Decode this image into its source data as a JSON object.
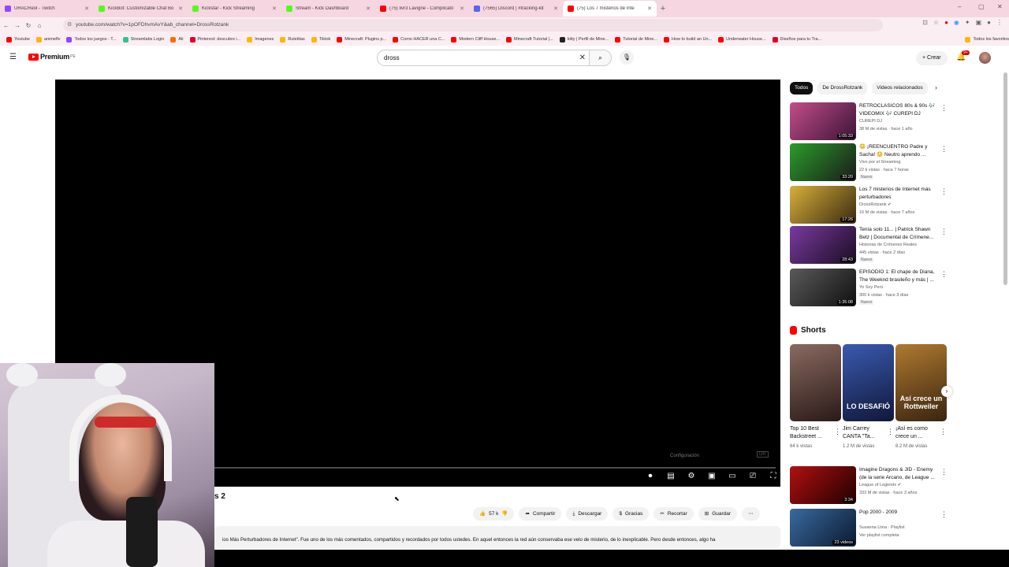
{
  "browser": {
    "tabs": [
      {
        "label": "URACReol - Twitch",
        "color": "#9146ff",
        "active": false
      },
      {
        "label": "KickBot: Customizable Chat Bo",
        "color": "#53fc18",
        "active": false
      },
      {
        "label": "Kickstar - Kick Streaming",
        "color": "#53fc18",
        "active": false
      },
      {
        "label": "Stream - Kick Dashboard",
        "color": "#53fc18",
        "active": false
      },
      {
        "label": "(75) livr3 Lavigne - Complicato",
        "color": "#ff0000",
        "active": false
      },
      {
        "label": "(7565) Discord | #tracking-kit",
        "color": "#5865f2",
        "active": false
      },
      {
        "label": "(75) Los 7 misterios de Inte",
        "color": "#ff0000",
        "active": true
      }
    ],
    "new_tab": "+",
    "window_controls": [
      "–",
      "▢",
      "✕"
    ],
    "url": "youtube.com/watch?v=1pOFDhvmAvY&ab_channel=DrossRotzank",
    "bookmarks": [
      {
        "label": "Youtube",
        "color": "#ff0000"
      },
      {
        "label": "animeflv",
        "color": "#ffb703"
      },
      {
        "label": "Todos los juegos - T...",
        "color": "#9146ff"
      },
      {
        "label": "Streamlabs Login",
        "color": "#31c48d"
      },
      {
        "label": "Ali",
        "color": "#ff6a00"
      },
      {
        "label": "Pinterest: descubre i...",
        "color": "#e60023"
      },
      {
        "label": "Imagenes",
        "color": "#ffb703"
      },
      {
        "label": "Ruletitas",
        "color": "#ffb703"
      },
      {
        "label": "Tiktok",
        "color": "#ffb703"
      },
      {
        "label": "Minecraft: Plugins p...",
        "color": "#ff0000"
      },
      {
        "label": "Como HACER una C...",
        "color": "#ff0000"
      },
      {
        "label": "Modern Cliff House...",
        "color": "#ff0000"
      },
      {
        "label": "Minecraft Tutorial |...",
        "color": "#ff0000"
      },
      {
        "label": "kitty | Perfil de Mine...",
        "color": "#222222"
      },
      {
        "label": "Tutorial de Mine...",
        "color": "#ff0000"
      },
      {
        "label": "How to build an Un...",
        "color": "#ff0000"
      },
      {
        "label": "Underwater House...",
        "color": "#ff0000"
      },
      {
        "label": "Diseños para tu Tra...",
        "color": "#e60023"
      },
      {
        "label": "Todos los favoritos",
        "color": "#ffb703"
      }
    ]
  },
  "youtube": {
    "logo_text": "Premium",
    "logo_sup": "PE",
    "search_value": "dross",
    "create_label": "Crear",
    "notif_count": "9+"
  },
  "player": {
    "config_label": "Configuración",
    "watermark": "DR"
  },
  "video": {
    "title_fragment": "s 2",
    "likes": "57 k",
    "actions": [
      "Compartir",
      "Descargar",
      "Gracias",
      "Recortar",
      "Guardar"
    ],
    "description": "ios Más Perturbadores de Internet\". Fue uno de los más comentados, compartidos y recordados por todos ustedes. En aquel entonces la red aún conservaba ese velo de misterio, de lo inexplicable. Pero desde entonces, algo ha"
  },
  "sidebar": {
    "chips": [
      "Todos",
      "De DrossRotzank",
      "Videos relacionados"
    ],
    "recs": [
      {
        "title": "RETROCLASICOS 80s & 90s 🎶 VIDEOMIX 🎶 CUREPI DJ",
        "channel": "CUREPI DJ",
        "meta": "38 M de vistas · hace 1 año",
        "duration": "1:05:33",
        "is_new": "",
        "thumb": [
          "#c44d8a",
          "#3a1436"
        ]
      },
      {
        "title": "😳 ¡REENCUENTRO Padre y Sacha! 😳 Neutro aprendo ...",
        "channel": "Vivo por el Streaming",
        "meta": "22 k vistas · hace 7 horas",
        "duration": "33:20",
        "is_new": "Nuevo",
        "thumb": [
          "#2a9d2a",
          "#1a1a1a"
        ]
      },
      {
        "title": "Los 7 misterios de Internet más perturbadores",
        "channel": "DrossRotzank ✔",
        "meta": "16 M de vistas · hace 7 años",
        "duration": "17:26",
        "is_new": "",
        "thumb": [
          "#d8b03a",
          "#3a2a10"
        ]
      },
      {
        "title": "Tenía solo 11... | Patrick Shawn Betz | Documental de Crímene...",
        "channel": "Historias de Crímenes Reales",
        "meta": "445 vistas · hace 2 días",
        "duration": "28:43",
        "is_new": "Nuevo",
        "thumb": [
          "#7a3aa0",
          "#1a0d22"
        ]
      },
      {
        "title": "EPISODIO 1: El chape de Diana, The Weeknd brasileño y más | ...",
        "channel": "Yo Soy Perú",
        "meta": "300 k vistas · hace 3 días",
        "duration": "1:35:08",
        "is_new": "Nuevo",
        "thumb": [
          "#5a5a5a",
          "#101010"
        ]
      }
    ],
    "shorts_header": "Shorts",
    "shorts": [
      {
        "title": "Top 10 Best Backstreet ...",
        "views": "64 k vistas",
        "caption": "",
        "colors": [
          "#8a6a60",
          "#2a1a18"
        ]
      },
      {
        "title": "Jim Carrey CANTA \"Ta...",
        "views": "1.2 M de vistas",
        "caption": "LO DESAFIÓ",
        "colors": [
          "#3a5ab0",
          "#10183a"
        ]
      },
      {
        "title": "¡Así es como crece un ...",
        "views": "8.2 M de vistas",
        "caption": "Así crece un Rottweiler",
        "colors": [
          "#b07a30",
          "#3a2410"
        ]
      }
    ],
    "recs2": [
      {
        "title": "Imagine Dragons & JID - Enemy (de la serie Arcano, de League ...",
        "channel": "League of Legends ✔",
        "meta": "333 M de vistas · hace 3 años",
        "duration": "3:34",
        "thumb": [
          "#b01010",
          "#200000"
        ],
        "meta2": ""
      },
      {
        "title": "Pop 2000 - 2009",
        "channel": "Susanna Lima · Playlist",
        "meta": "Ver playlist completa",
        "duration": "23 videos",
        "thumb": [
          "#3a6aa0",
          "#0a1a30"
        ],
        "meta2": ""
      }
    ]
  }
}
